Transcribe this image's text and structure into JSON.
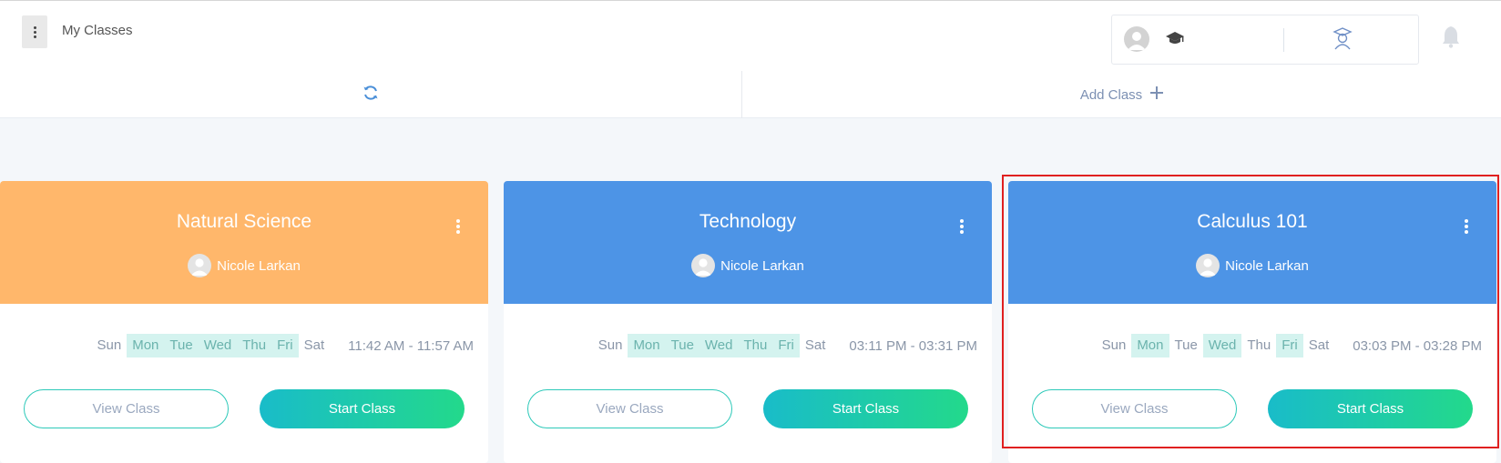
{
  "header": {
    "title": "My Classes",
    "menu_icon": "vertical-dots-icon",
    "account_icons": [
      "user-avatar-icon",
      "graduation-cap-icon",
      "teacher-icon"
    ],
    "notifications_icon": "bell-icon"
  },
  "toolbar": {
    "refresh_icon": "refresh-icon",
    "add_class_label": "Add Class",
    "add_icon": "plus-icon"
  },
  "colors": {
    "orange": "#ffb76b",
    "blue": "#4d94e6",
    "accent_teal": "#2dc9b9",
    "day_highlight": "#d4f3ef"
  },
  "classes": [
    {
      "title": "Natural Science",
      "teacher": "Nicole Larkan",
      "color": "#ffb76b",
      "days": [
        {
          "label": "Sun",
          "active": false
        },
        {
          "label": "Mon",
          "active": true
        },
        {
          "label": "Tue",
          "active": true
        },
        {
          "label": "Wed",
          "active": true
        },
        {
          "label": "Thu",
          "active": true
        },
        {
          "label": "Fri",
          "active": true
        },
        {
          "label": "Sat",
          "active": false
        }
      ],
      "time": "11:42 AM - 11:57 AM",
      "view_label": "View Class",
      "start_label": "Start Class"
    },
    {
      "title": "Technology",
      "teacher": "Nicole Larkan",
      "color": "#4d94e6",
      "days": [
        {
          "label": "Sun",
          "active": false
        },
        {
          "label": "Mon",
          "active": true
        },
        {
          "label": "Tue",
          "active": true
        },
        {
          "label": "Wed",
          "active": true
        },
        {
          "label": "Thu",
          "active": true
        },
        {
          "label": "Fri",
          "active": true
        },
        {
          "label": "Sat",
          "active": false
        }
      ],
      "time": "03:11 PM - 03:31 PM",
      "view_label": "View Class",
      "start_label": "Start Class"
    },
    {
      "title": "Calculus 101",
      "teacher": "Nicole Larkan",
      "color": "#4d94e6",
      "days": [
        {
          "label": "Sun",
          "active": false
        },
        {
          "label": "Mon",
          "active": true
        },
        {
          "label": "Tue",
          "active": false
        },
        {
          "label": "Wed",
          "active": true
        },
        {
          "label": "Thu",
          "active": false
        },
        {
          "label": "Fri",
          "active": true
        },
        {
          "label": "Sat",
          "active": false
        }
      ],
      "time": "03:03 PM - 03:28 PM",
      "view_label": "View Class",
      "start_label": "Start Class"
    }
  ]
}
